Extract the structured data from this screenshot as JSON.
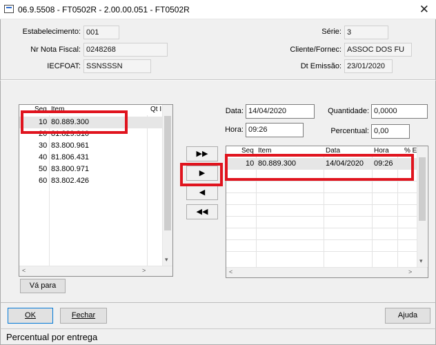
{
  "window": {
    "title": "06.9.5508 - FT0502R - 2.00.00.051 - FT0502R"
  },
  "header": {
    "estabelecimento": {
      "label": "Estabelecimento:",
      "value": "001"
    },
    "nr_nota": {
      "label": "Nr Nota Fiscal:",
      "value": "0248268"
    },
    "iecfoat": {
      "label": "IECFOAT:",
      "value": "SSNSSSN"
    },
    "serie": {
      "label": "Série:",
      "value": "3"
    },
    "cliente": {
      "label": "Cliente/Fornec:",
      "value": "ASSOC DOS FU"
    },
    "dt_emissao": {
      "label": "Dt Emissão:",
      "value": "23/01/2020"
    }
  },
  "left_grid": {
    "columns": {
      "seq": "Seq",
      "item": "Item",
      "qt": "Qt I"
    },
    "rows": [
      {
        "seq": "10",
        "item": "80.889.300"
      },
      {
        "seq": "20",
        "item": "81.829.310"
      },
      {
        "seq": "30",
        "item": "83.800.961"
      },
      {
        "seq": "40",
        "item": "81.806.431"
      },
      {
        "seq": "50",
        "item": "83.800.971"
      },
      {
        "seq": "60",
        "item": "83.802.426"
      }
    ]
  },
  "form": {
    "data": {
      "label": "Data:",
      "value": "14/04/2020"
    },
    "hora": {
      "label": "Hora:",
      "value": "09:26"
    },
    "quantidade": {
      "label": "Quantidade:",
      "value": "0,0000"
    },
    "percentual": {
      "label": "Percentual:",
      "value": "0,00"
    }
  },
  "move_buttons": {
    "add_all": "▶▶",
    "add_one": "▶",
    "remove_one": "◀",
    "remove_all": "◀◀"
  },
  "right_grid": {
    "columns": {
      "seq": "Seq",
      "item": "Item",
      "data": "Data",
      "hora": "Hora",
      "pct": "% E"
    },
    "rows": [
      {
        "seq": "10",
        "item": "80.889.300",
        "data": "14/04/2020",
        "hora": "09:26"
      }
    ]
  },
  "buttons": {
    "va_para": "Vá para",
    "ok": "OK",
    "fechar": "Fechar",
    "ajuda": "Ajuda"
  },
  "status": {
    "text": "Percentual por entrega"
  },
  "colors": {
    "highlight": "#e0141e",
    "panel": "#f0f0f0",
    "selected_row": "#e6e6e6"
  }
}
